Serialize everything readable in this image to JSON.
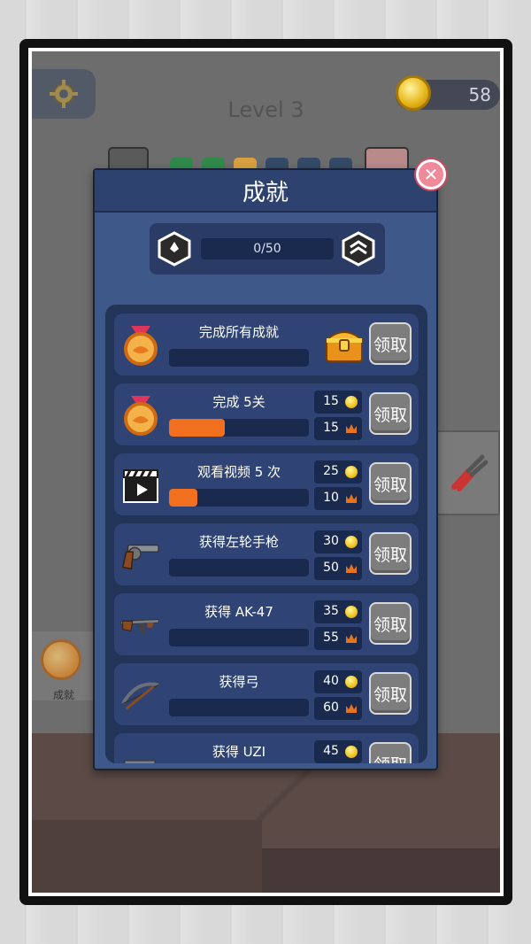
{
  "hud": {
    "coins": "58",
    "level": "Level 3",
    "side_tab_label": "成就"
  },
  "dialog": {
    "title": "成就",
    "progress": "0/50",
    "claim_label": "领取",
    "achievements": [
      {
        "title": "完成所有成就",
        "progress": 0.0,
        "reward_type": "chest",
        "icon": "medal-icon"
      },
      {
        "title": "完成 5关",
        "progress": 0.4,
        "coins": "15",
        "crowns": "15",
        "icon": "medal-icon"
      },
      {
        "title": "观看视频 5 次",
        "progress": 0.2,
        "coins": "25",
        "crowns": "10",
        "icon": "video-clapper-icon"
      },
      {
        "title": "获得左轮手枪",
        "progress": 0.0,
        "coins": "30",
        "crowns": "50",
        "icon": "revolver-icon"
      },
      {
        "title": "获得 AK-47",
        "progress": 0.0,
        "coins": "35",
        "crowns": "55",
        "icon": "rifle-icon"
      },
      {
        "title": "获得弓",
        "progress": 0.0,
        "coins": "40",
        "crowns": "60",
        "icon": "bow-icon"
      },
      {
        "title": "获得 UZI",
        "progress": 0.0,
        "coins": "45",
        "crowns": "",
        "icon": "uzi-icon"
      }
    ]
  },
  "colors": {
    "dialog_bg": "#3e5889",
    "progress_fill": "#f07020",
    "claim_button": "#7d7d7d"
  }
}
